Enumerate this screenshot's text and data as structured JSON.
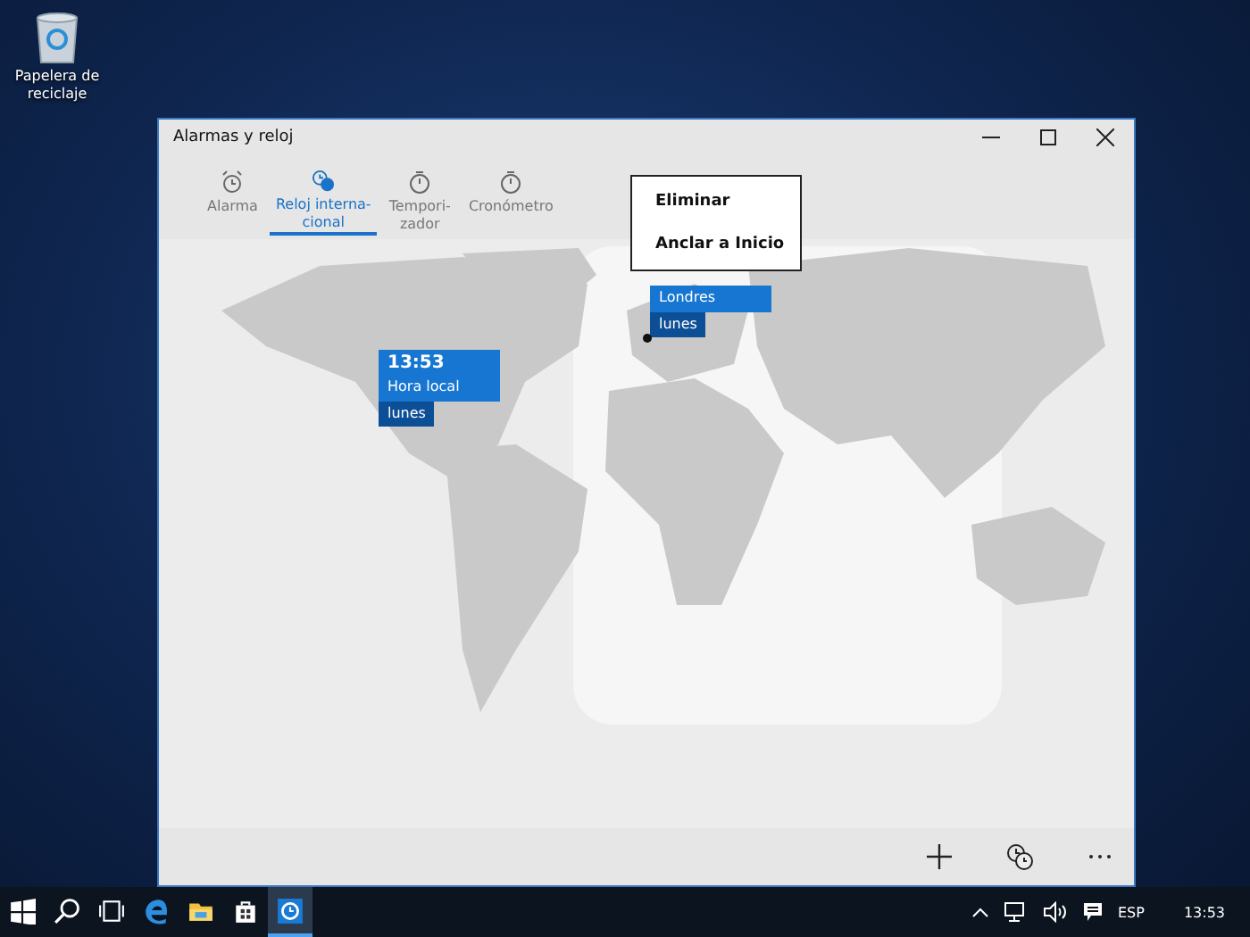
{
  "desktop": {
    "icons": [
      {
        "label": "Papelera de reciclaje"
      }
    ]
  },
  "window": {
    "title": "Alarmas y reloj",
    "tabs": [
      {
        "label": "Alarma",
        "kind": "alarm",
        "selected": false
      },
      {
        "label": "Reloj interna-\ncional",
        "kind": "world",
        "selected": true
      },
      {
        "label": "Tempori-\nzador",
        "kind": "timer",
        "selected": false
      },
      {
        "label": "Cronómetro",
        "kind": "stopwatch",
        "selected": false
      }
    ],
    "map": {
      "clocks": [
        {
          "time": "13:53",
          "place": "Hora local",
          "day": "lunes",
          "pin": false
        },
        {
          "place": "Londres",
          "day": "lunes",
          "pin": true
        }
      ]
    },
    "context_menu": {
      "items": [
        "Eliminar",
        "Anclar a Inicio"
      ]
    }
  },
  "taskbar": {
    "apps": [
      {
        "kind": "start",
        "selected": false
      },
      {
        "kind": "search",
        "selected": false
      },
      {
        "kind": "taskview",
        "selected": false
      },
      {
        "kind": "edge",
        "selected": false
      },
      {
        "kind": "explorer",
        "selected": false
      },
      {
        "kind": "store",
        "selected": false
      },
      {
        "kind": "alarms",
        "selected": true
      }
    ],
    "language": "ESP",
    "time": "13:53"
  }
}
